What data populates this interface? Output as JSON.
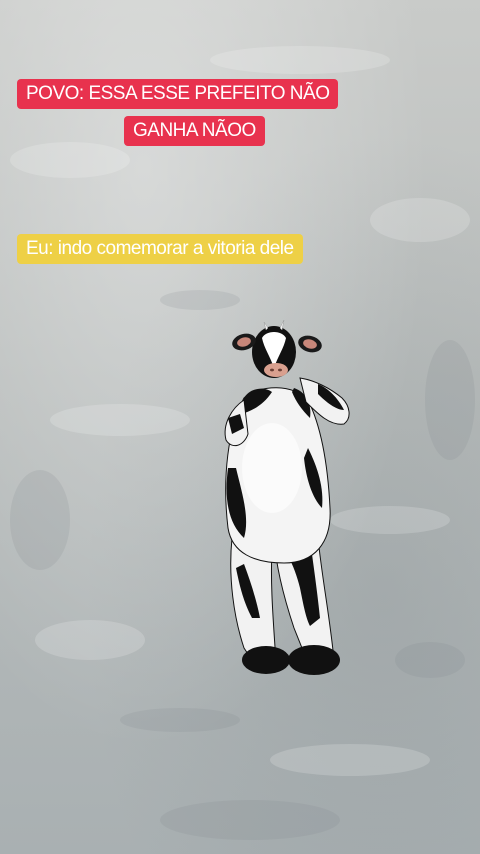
{
  "captions": {
    "line1": "POVO: ESSA ESSE PREFEITO NÃO",
    "line2": "GANHA NÃOO",
    "line3": "Eu: indo comemorar a vitoria dele"
  },
  "colors": {
    "red_caption_bg": "#e8324e",
    "yellow_caption_bg": "#eed046",
    "caption_text": "#ffffff"
  }
}
